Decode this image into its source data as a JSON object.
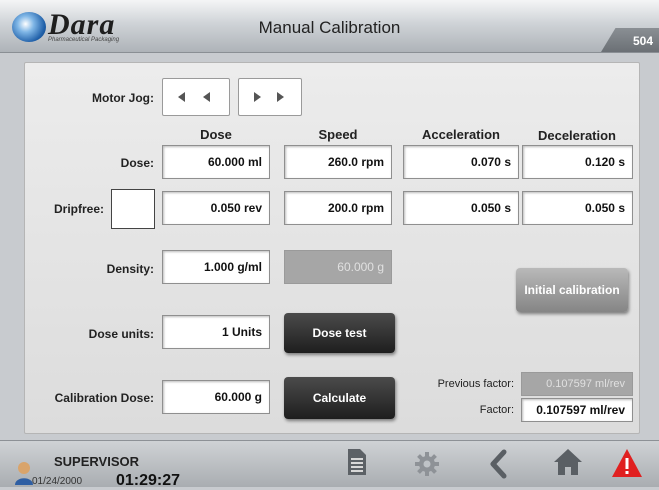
{
  "header": {
    "brand": "Dara",
    "brand_sub": "Pharmaceutical Packaging",
    "title": "Manual Calibration",
    "screen_number": "504"
  },
  "motor_jog": {
    "label": "Motor Jog:"
  },
  "columns": {
    "dose": "Dose",
    "speed": "Speed",
    "acceleration": "Acceleration",
    "deceleration": "Deceleration"
  },
  "dose_row": {
    "label": "Dose:",
    "dose": "60.000  ml",
    "speed": "260.0 rpm",
    "acceleration": "0.070 s",
    "deceleration": "0.120 s"
  },
  "dripfree_row": {
    "label": "Dripfree:",
    "checked": false,
    "dose": "0.050 rev",
    "speed": "200.0 rpm",
    "acceleration": "0.050 s",
    "deceleration": "0.050 s"
  },
  "density": {
    "label": "Density:",
    "value": "1.000 g/ml",
    "readonly_value": "60.000 g"
  },
  "dose_units": {
    "label": "Dose units:",
    "value": "1 Units"
  },
  "calibration": {
    "label": "Calibration Dose:",
    "value": "60.000  g"
  },
  "buttons": {
    "dose_test": "Dose test",
    "calculate": "Calculate",
    "initial_calibration": "Initial calibration"
  },
  "factors": {
    "previous_label": "Previous factor:",
    "previous_value": "0.107597 ml/rev",
    "factor_label": "Factor:",
    "factor_value": "0.107597 ml/rev"
  },
  "footer": {
    "user": "SUPERVISOR",
    "date": "01/24/2000",
    "time": "01:29:27"
  },
  "colors": {
    "button_dark": "#2a2a2a",
    "alarm_red": "#e02020",
    "panel": "#e4e4e4"
  }
}
